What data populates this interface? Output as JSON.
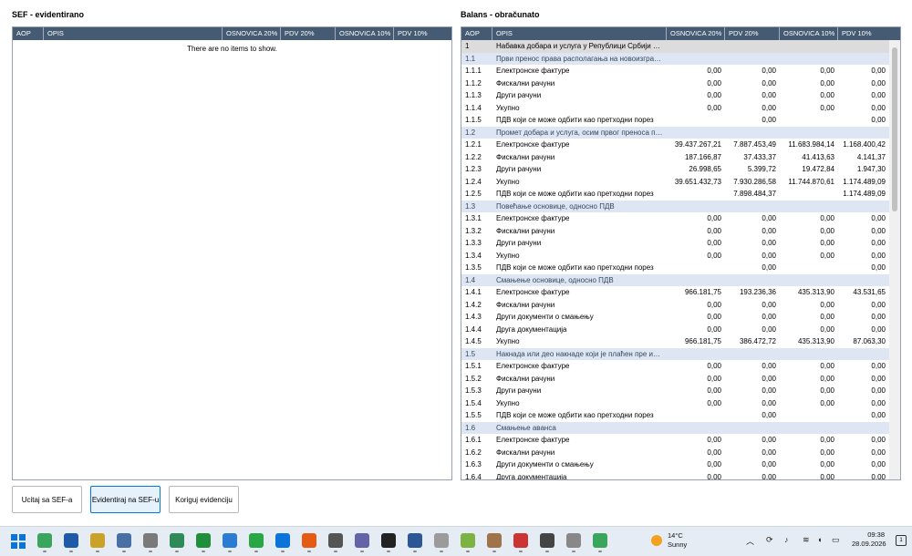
{
  "left": {
    "title": "SEF - evidentirano",
    "columns": [
      "AOP",
      "OPIS",
      "OSNOVICA 20%",
      "PDV 20%",
      "OSNOVICA 10%",
      "PDV 10%"
    ],
    "empty_text": "There are no items to show."
  },
  "right": {
    "title": "Balans - obračunato",
    "columns": [
      "AOP",
      "OPIS",
      "OSNOVICA 20%",
      "PDV 20%",
      "OSNOVICA 10%",
      "PDV 10%"
    ],
    "rows": [
      {
        "aop": "1",
        "opis": "Набавка добара и услуга у Републици Србији од о...",
        "o20": "",
        "p20": "",
        "o10": "",
        "p10": "",
        "kind": "sel"
      },
      {
        "aop": "1.1",
        "opis": "Први пренос права располагања на новоизграђе...",
        "o20": "",
        "p20": "",
        "o10": "",
        "p10": "",
        "kind": "sec"
      },
      {
        "aop": "1.1.1",
        "opis": "Електронске фактуре",
        "o20": "0,00",
        "p20": "0,00",
        "o10": "0,00",
        "p10": "0,00",
        "kind": ""
      },
      {
        "aop": "1.1.2",
        "opis": "Фискални рачуни",
        "o20": "0,00",
        "p20": "0,00",
        "o10": "0,00",
        "p10": "0,00",
        "kind": ""
      },
      {
        "aop": "1.1.3",
        "opis": "Други рачуни",
        "o20": "0,00",
        "p20": "0,00",
        "o10": "0,00",
        "p10": "0,00",
        "kind": ""
      },
      {
        "aop": "1.1.4",
        "opis": "Укупно",
        "o20": "0,00",
        "p20": "0,00",
        "o10": "0,00",
        "p10": "0,00",
        "kind": ""
      },
      {
        "aop": "1.1.5",
        "opis": "ПДВ који се може одбити као претходни порез",
        "o20": "",
        "p20": "0,00",
        "o10": "",
        "p10": "0,00",
        "kind": ""
      },
      {
        "aop": "1.2",
        "opis": "Промет добара и услуга, осим првог преноса пра...",
        "o20": "",
        "p20": "",
        "o10": "",
        "p10": "",
        "kind": "sec"
      },
      {
        "aop": "1.2.1",
        "opis": "Електронске фактуре",
        "o20": "39.437.267,21",
        "p20": "7.887.453,49",
        "o10": "11.683.984,14",
        "p10": "1.168.400,42",
        "kind": ""
      },
      {
        "aop": "1.2.2",
        "opis": "Фискални рачуни",
        "o20": "187.166,87",
        "p20": "37.433,37",
        "o10": "41.413,63",
        "p10": "4.141,37",
        "kind": ""
      },
      {
        "aop": "1.2.3",
        "opis": "Други рачуни",
        "o20": "26.998,65",
        "p20": "5.399,72",
        "o10": "19.472,84",
        "p10": "1.947,30",
        "kind": ""
      },
      {
        "aop": "1.2.4",
        "opis": "Укупно",
        "o20": "39.651.432,73",
        "p20": "7.930.286,58",
        "o10": "11.744.870,61",
        "p10": "1.174.489,09",
        "kind": ""
      },
      {
        "aop": "1.2.5",
        "opis": "ПДВ који се може одбити као претходни порез",
        "o20": "",
        "p20": "7.898.484,37",
        "o10": "",
        "p10": "1.174.489,09",
        "kind": ""
      },
      {
        "aop": "1.3",
        "opis": "Повећање основице, односно ПДВ",
        "o20": "",
        "p20": "",
        "o10": "",
        "p10": "",
        "kind": "sec"
      },
      {
        "aop": "1.3.1",
        "opis": "Електронске фактуре",
        "o20": "0,00",
        "p20": "0,00",
        "o10": "0,00",
        "p10": "0,00",
        "kind": ""
      },
      {
        "aop": "1.3.2",
        "opis": "Фискални рачуни",
        "o20": "0,00",
        "p20": "0,00",
        "o10": "0,00",
        "p10": "0,00",
        "kind": ""
      },
      {
        "aop": "1.3.3",
        "opis": "Други рачуни",
        "o20": "0,00",
        "p20": "0,00",
        "o10": "0,00",
        "p10": "0,00",
        "kind": ""
      },
      {
        "aop": "1.3.4",
        "opis": "Укупно",
        "o20": "0,00",
        "p20": "0,00",
        "o10": "0,00",
        "p10": "0,00",
        "kind": ""
      },
      {
        "aop": "1.3.5",
        "opis": "ПДВ који се може одбити као претходни порез",
        "o20": "",
        "p20": "0,00",
        "o10": "",
        "p10": "0,00",
        "kind": ""
      },
      {
        "aop": "1.4",
        "opis": "Смањење основице, односно ПДВ",
        "o20": "",
        "p20": "",
        "o10": "",
        "p10": "",
        "kind": "sec"
      },
      {
        "aop": "1.4.1",
        "opis": "Електронске фактуре",
        "o20": "966.181,75",
        "p20": "193.236,36",
        "o10": "435.313,90",
        "p10": "43.531,65",
        "kind": ""
      },
      {
        "aop": "1.4.2",
        "opis": "Фискални рачуни",
        "o20": "0,00",
        "p20": "0,00",
        "o10": "0,00",
        "p10": "0,00",
        "kind": ""
      },
      {
        "aop": "1.4.3",
        "opis": "Други документи о смањењу",
        "o20": "0,00",
        "p20": "0,00",
        "o10": "0,00",
        "p10": "0,00",
        "kind": ""
      },
      {
        "aop": "1.4.4",
        "opis": "Друга документација",
        "o20": "0,00",
        "p20": "0,00",
        "o10": "0,00",
        "p10": "0,00",
        "kind": ""
      },
      {
        "aop": "1.4.5",
        "opis": "Укупно",
        "o20": "966.181,75",
        "p20": "386.472,72",
        "o10": "435.313,90",
        "p10": "87.063,30",
        "kind": ""
      },
      {
        "aop": "1.5",
        "opis": "Накнада или део накнаде који је плаћен пре извр...",
        "o20": "",
        "p20": "",
        "o10": "",
        "p10": "",
        "kind": "sec"
      },
      {
        "aop": "1.5.1",
        "opis": "Електронске фактуре",
        "o20": "0,00",
        "p20": "0,00",
        "o10": "0,00",
        "p10": "0,00",
        "kind": ""
      },
      {
        "aop": "1.5.2",
        "opis": "Фискални рачуни",
        "o20": "0,00",
        "p20": "0,00",
        "o10": "0,00",
        "p10": "0,00",
        "kind": ""
      },
      {
        "aop": "1.5.3",
        "opis": "Други рачуни",
        "o20": "0,00",
        "p20": "0,00",
        "o10": "0,00",
        "p10": "0,00",
        "kind": ""
      },
      {
        "aop": "1.5.4",
        "opis": "Укупно",
        "o20": "0,00",
        "p20": "0,00",
        "o10": "0,00",
        "p10": "0,00",
        "kind": ""
      },
      {
        "aop": "1.5.5",
        "opis": "ПДВ који се може одбити као претходни порез",
        "o20": "",
        "p20": "0,00",
        "o10": "",
        "p10": "0,00",
        "kind": ""
      },
      {
        "aop": "1.6",
        "opis": "Смањење аванса",
        "o20": "",
        "p20": "",
        "o10": "",
        "p10": "",
        "kind": "sec"
      },
      {
        "aop": "1.6.1",
        "opis": "Електронске фактуре",
        "o20": "0,00",
        "p20": "0,00",
        "o10": "0,00",
        "p10": "0,00",
        "kind": ""
      },
      {
        "aop": "1.6.2",
        "opis": "Фискални рачуни",
        "o20": "0,00",
        "p20": "0,00",
        "o10": "0,00",
        "p10": "0,00",
        "kind": ""
      },
      {
        "aop": "1.6.3",
        "opis": "Други документи о смањењу",
        "o20": "0,00",
        "p20": "0,00",
        "o10": "0,00",
        "p10": "0,00",
        "kind": ""
      },
      {
        "aop": "1.6.4",
        "opis": "Друга документација",
        "o20": "0,00",
        "p20": "0,00",
        "o10": "0,00",
        "p10": "0,00",
        "kind": ""
      }
    ]
  },
  "buttons": {
    "ucitaj": "Ucitaj sa SEF-a",
    "evidentiraj": "Evidentiraj na SEF-u",
    "koriguj": "Koriguj evidenciju"
  },
  "taskbar": {
    "icons": [
      "start-icon",
      "search-icon",
      "app-icon-1",
      "app-icon-2",
      "app-icon-3",
      "app-icon-4",
      "app-icon-5",
      "app-icon-6",
      "app-icon-7",
      "app-icon-8",
      "app-icon-9",
      "app-icon-10",
      "app-icon-11",
      "app-icon-12",
      "app-icon-13",
      "app-icon-14",
      "app-icon-15",
      "app-icon-16",
      "app-icon-17",
      "app-icon-18",
      "app-icon-19",
      "app-icon-20",
      "app-icon-21"
    ],
    "weather_temp": "14°C",
    "weather_desc": "Sunny",
    "time": "09:38",
    "date": "28.09.2026"
  },
  "colors": {
    "header_bg": "#455a73",
    "section_bg": "#dde6f2",
    "accent": "#0078d7"
  }
}
